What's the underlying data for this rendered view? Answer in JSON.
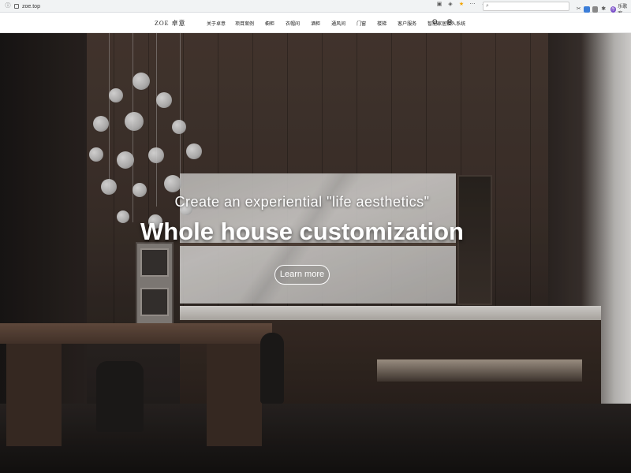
{
  "browser": {
    "url": "zoe.top",
    "user_label": "乐歌客",
    "search_placeholder": ""
  },
  "header": {
    "logo": "ZOE 卓意",
    "nav": [
      {
        "label": "关于卓意"
      },
      {
        "label": "项目案例"
      },
      {
        "label": "橱柜"
      },
      {
        "label": "衣帽间"
      },
      {
        "label": "酒柜"
      },
      {
        "label": "通风间"
      },
      {
        "label": "门窗"
      },
      {
        "label": "楼梯"
      },
      {
        "label": "客户服务"
      },
      {
        "label": "智能家居接入系统"
      }
    ]
  },
  "hero": {
    "subtitle": "Create an experiential \"life aesthetics\"",
    "title": "Whole house customization",
    "cta_label": "Learn more"
  },
  "colors": {
    "header_bg": "#ffffff",
    "hero_text": "#ffffff",
    "accent_ext1": "#3b7dd8",
    "accent_ext2": "#4a4a4a",
    "avatar": "#7b4fc9"
  }
}
